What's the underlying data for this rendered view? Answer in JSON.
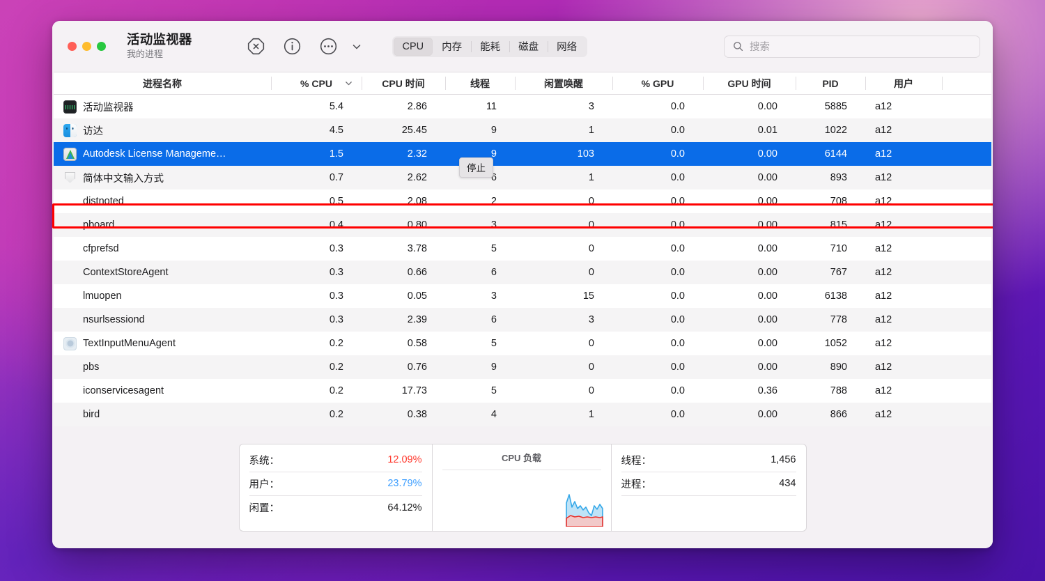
{
  "window": {
    "title": "活动监视器",
    "subtitle": "我的进程",
    "traffic_lights": [
      "close",
      "minimize",
      "zoom"
    ]
  },
  "toolbar": {
    "stop_label": "停止",
    "icons": [
      "stop-octagon-icon",
      "info-circle-icon",
      "more-circle-icon",
      "chevron-down-icon"
    ],
    "tabs": [
      {
        "label": "CPU",
        "active": true
      },
      {
        "label": "内存",
        "active": false
      },
      {
        "label": "能耗",
        "active": false
      },
      {
        "label": "磁盘",
        "active": false
      },
      {
        "label": "网络",
        "active": false
      }
    ],
    "search": {
      "placeholder": "搜索",
      "value": ""
    }
  },
  "table": {
    "columns": [
      "进程名称",
      "% CPU",
      "CPU 时间",
      "线程",
      "闲置唤醒",
      "% GPU",
      "GPU 时间",
      "PID",
      "用户"
    ],
    "sort_column": "% CPU",
    "rows": [
      {
        "icon": "activity-monitor-icon",
        "name": "活动监视器",
        "cpu": "5.4",
        "cpu_time": "2.86",
        "threads": "11",
        "idle_wake": "3",
        "gpu": "0.0",
        "gpu_time": "0.00",
        "pid": "5885",
        "user": "a12",
        "selected": false
      },
      {
        "icon": "finder-icon",
        "name": "访达",
        "cpu": "4.5",
        "cpu_time": "25.45",
        "threads": "9",
        "idle_wake": "1",
        "gpu": "0.0",
        "gpu_time": "0.01",
        "pid": "1022",
        "user": "a12",
        "selected": false
      },
      {
        "icon": "autodesk-icon",
        "name": "Autodesk License Manageme…",
        "cpu": "1.5",
        "cpu_time": "2.32",
        "threads": "9",
        "idle_wake": "103",
        "gpu": "0.0",
        "gpu_time": "0.00",
        "pid": "6144",
        "user": "a12",
        "selected": true
      },
      {
        "icon": "shield-icon",
        "name": "简体中文输入方式",
        "cpu": "0.7",
        "cpu_time": "2.62",
        "threads": "6",
        "idle_wake": "1",
        "gpu": "0.0",
        "gpu_time": "0.00",
        "pid": "893",
        "user": "a12",
        "selected": false
      },
      {
        "icon": "",
        "name": "distnoted",
        "cpu": "0.5",
        "cpu_time": "2.08",
        "threads": "2",
        "idle_wake": "0",
        "gpu": "0.0",
        "gpu_time": "0.00",
        "pid": "708",
        "user": "a12",
        "selected": false
      },
      {
        "icon": "",
        "name": "pboard",
        "cpu": "0.4",
        "cpu_time": "0.80",
        "threads": "3",
        "idle_wake": "0",
        "gpu": "0.0",
        "gpu_time": "0.00",
        "pid": "815",
        "user": "a12",
        "selected": false
      },
      {
        "icon": "",
        "name": "cfprefsd",
        "cpu": "0.3",
        "cpu_time": "3.78",
        "threads": "5",
        "idle_wake": "0",
        "gpu": "0.0",
        "gpu_time": "0.00",
        "pid": "710",
        "user": "a12",
        "selected": false
      },
      {
        "icon": "",
        "name": "ContextStoreAgent",
        "cpu": "0.3",
        "cpu_time": "0.66",
        "threads": "6",
        "idle_wake": "0",
        "gpu": "0.0",
        "gpu_time": "0.00",
        "pid": "767",
        "user": "a12",
        "selected": false
      },
      {
        "icon": "",
        "name": "lmuopen",
        "cpu": "0.3",
        "cpu_time": "0.05",
        "threads": "3",
        "idle_wake": "15",
        "gpu": "0.0",
        "gpu_time": "0.00",
        "pid": "6138",
        "user": "a12",
        "selected": false
      },
      {
        "icon": "",
        "name": "nsurlsessiond",
        "cpu": "0.3",
        "cpu_time": "2.39",
        "threads": "6",
        "idle_wake": "3",
        "gpu": "0.0",
        "gpu_time": "0.00",
        "pid": "778",
        "user": "a12",
        "selected": false
      },
      {
        "icon": "text-input-menu-icon",
        "name": "TextInputMenuAgent",
        "cpu": "0.2",
        "cpu_time": "0.58",
        "threads": "5",
        "idle_wake": "0",
        "gpu": "0.0",
        "gpu_time": "0.00",
        "pid": "1052",
        "user": "a12",
        "selected": false
      },
      {
        "icon": "",
        "name": "pbs",
        "cpu": "0.2",
        "cpu_time": "0.76",
        "threads": "9",
        "idle_wake": "0",
        "gpu": "0.0",
        "gpu_time": "0.00",
        "pid": "890",
        "user": "a12",
        "selected": false
      },
      {
        "icon": "",
        "name": "iconservicesagent",
        "cpu": "0.2",
        "cpu_time": "17.73",
        "threads": "5",
        "idle_wake": "0",
        "gpu": "0.0",
        "gpu_time": "0.36",
        "pid": "788",
        "user": "a12",
        "selected": false
      },
      {
        "icon": "",
        "name": "bird",
        "cpu": "0.2",
        "cpu_time": "0.38",
        "threads": "4",
        "idle_wake": "1",
        "gpu": "0.0",
        "gpu_time": "0.00",
        "pid": "866",
        "user": "a12",
        "selected": false
      }
    ]
  },
  "footer": {
    "cpu_stats": [
      {
        "label": "系统：",
        "value": "12.09%",
        "color": "#ff3b30"
      },
      {
        "label": "用户：",
        "value": "23.79%",
        "color": "#3b9dff"
      },
      {
        "label": "闲置：",
        "value": "64.12%",
        "color": "#1b1b1d"
      }
    ],
    "graph_title": "CPU 负载",
    "counts": [
      {
        "label": "线程：",
        "value": "1,456"
      },
      {
        "label": "进程：",
        "value": "434"
      }
    ]
  },
  "colors": {
    "selection_blue": "#0a6ce8",
    "annotation_red": "#ff0000",
    "system_red": "#ff3b30",
    "user_blue": "#3b9dff"
  }
}
